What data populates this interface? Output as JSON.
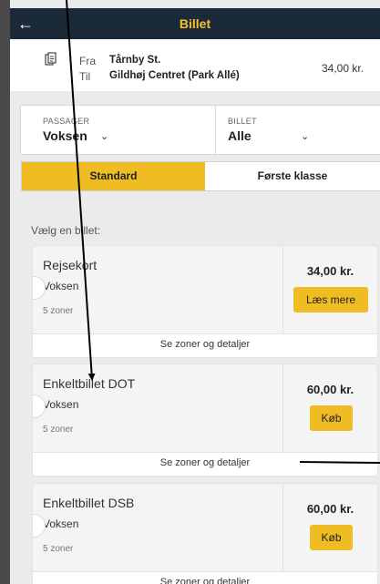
{
  "header": {
    "back_label": "←",
    "title": "Billet"
  },
  "route": {
    "from_label": "Fra",
    "from_value": "Tårnby St.",
    "to_label": "Til",
    "to_value": "Gildhøj Centret (Park Allé)",
    "price": "34,00 kr."
  },
  "selectors": {
    "passenger_label": "PASSAGER",
    "passenger_value": "Voksen",
    "ticket_label": "BILLET",
    "ticket_value": "Alle",
    "chevron": "⌄"
  },
  "tabs": [
    {
      "label": "Standard",
      "active": true
    },
    {
      "label": "Første klasse",
      "active": false
    }
  ],
  "prompt": "Vælg en billet:",
  "tickets": [
    {
      "name": "Rejsekort",
      "passenger": "Voksen",
      "zones": "5 zoner",
      "price": "34,00 kr.",
      "action": "Læs mere",
      "details": "Se zoner og detaljer"
    },
    {
      "name": "Enkeltbillet DOT",
      "passenger": "Voksen",
      "zones": "5 zoner",
      "price": "60,00 kr.",
      "action": "Køb",
      "details": "Se zoner og detaljer"
    },
    {
      "name": "Enkeltbillet DSB",
      "passenger": "Voksen",
      "zones": "5 zoner",
      "price": "60,00 kr.",
      "action": "Køb",
      "details": "Se zoner og detaljer"
    }
  ],
  "colors": {
    "header_bg": "#1b2a38",
    "accent": "#f0bc24",
    "header_title": "#f5c02b"
  },
  "icons": {
    "back": "arrow-left-icon",
    "ticket": "document-icon",
    "chevron": "chevron-down-icon"
  }
}
